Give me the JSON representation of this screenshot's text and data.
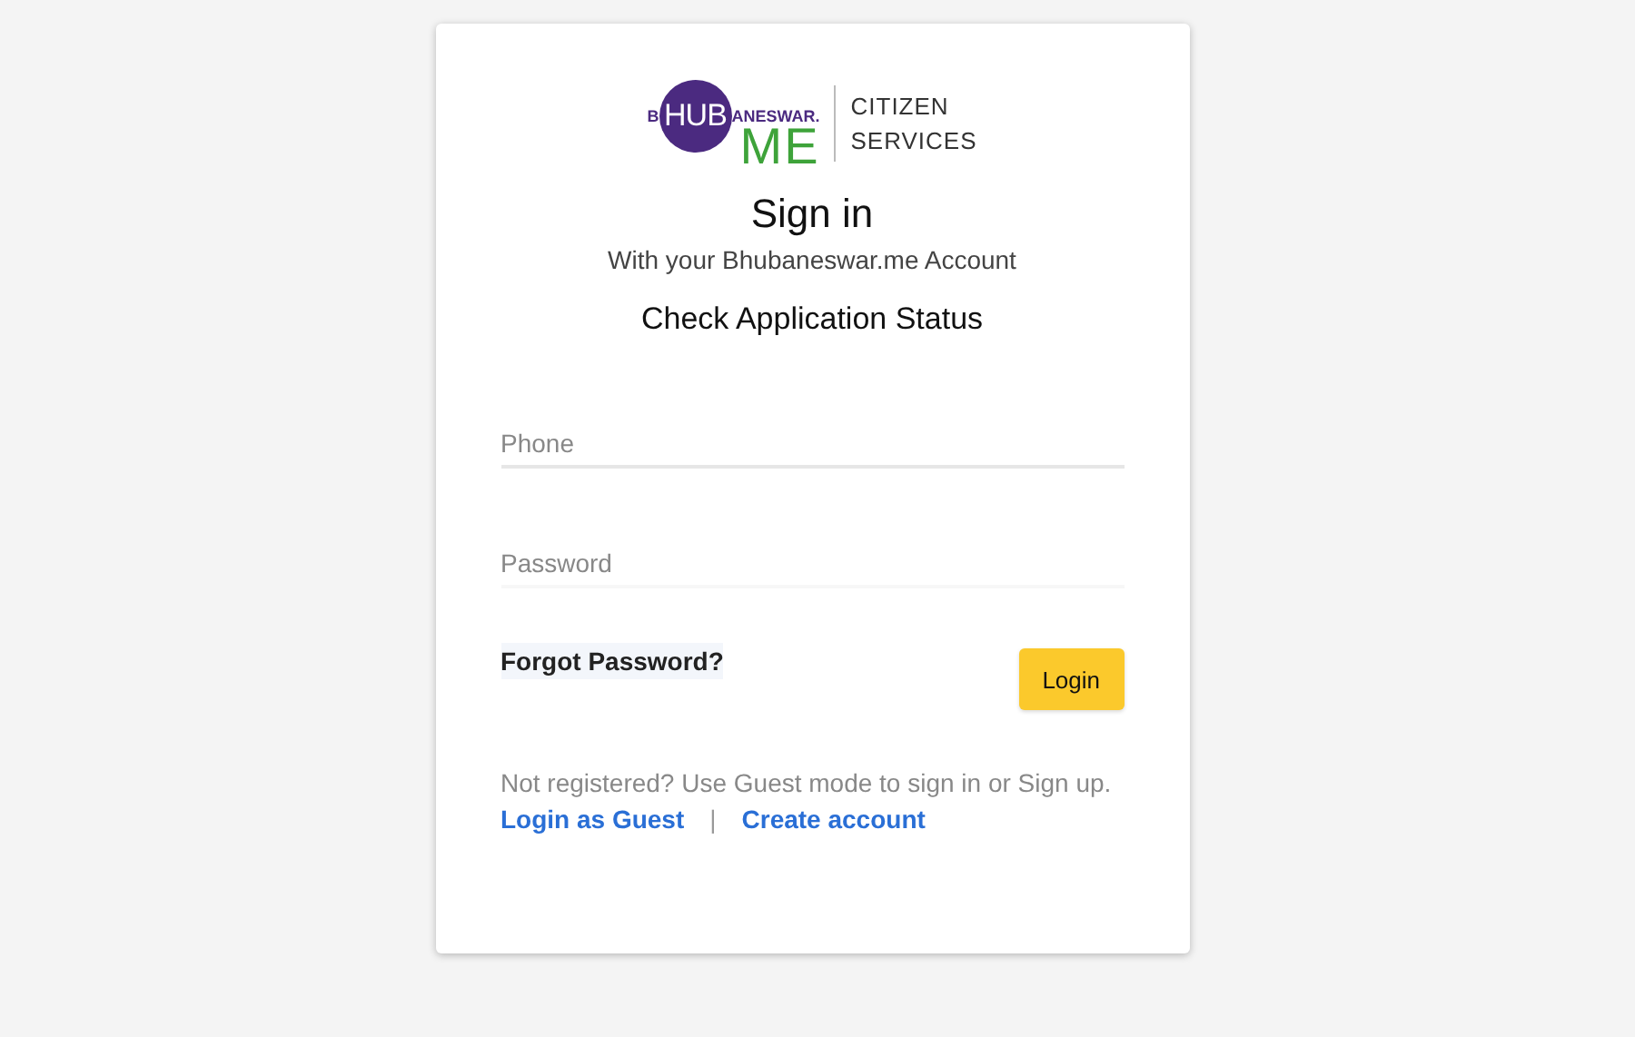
{
  "logo": {
    "prefix": "B",
    "circle_text": "HUB",
    "suffix": "ANESWAR.",
    "mark": "ME",
    "tagline": [
      "CITIZEN",
      "SERVICES"
    ]
  },
  "title": "Sign in",
  "subtitle": "With your Bhubaneswar.me Account",
  "heading": "Check Application Status",
  "fields": [
    {
      "placeholder": "Phone",
      "kind": "phone"
    },
    {
      "placeholder": "Password",
      "kind": "password"
    }
  ],
  "forgot_link": "Forgot Password?",
  "login_button": "Login",
  "note": "Not registered? Use Guest mode to sign in or Sign up.",
  "links": [
    "Login as Guest",
    "Create account"
  ],
  "separator": "|"
}
